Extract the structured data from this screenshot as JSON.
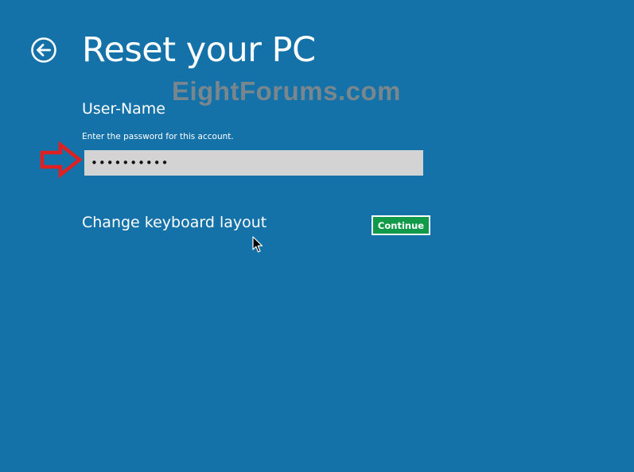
{
  "header": {
    "back_icon": "back-arrow-circle-icon",
    "title": "Reset your PC"
  },
  "watermark": {
    "text": "EightForums.com"
  },
  "account": {
    "name": "User-Name",
    "instruction": "Enter the password for this account."
  },
  "password_field": {
    "value": "••••••••••",
    "masked": true
  },
  "annotation": {
    "icon": "red-outline-arrow-icon",
    "color": "#e02020"
  },
  "actions": {
    "keyboard_link": "Change keyboard layout",
    "continue_label": "Continue"
  },
  "colors": {
    "background": "#1572a8",
    "continue_button": "#119a4a",
    "input_background": "#d3d3d3",
    "watermark": "#8a8a8a"
  },
  "cursor": {
    "icon": "mouse-pointer-icon"
  }
}
